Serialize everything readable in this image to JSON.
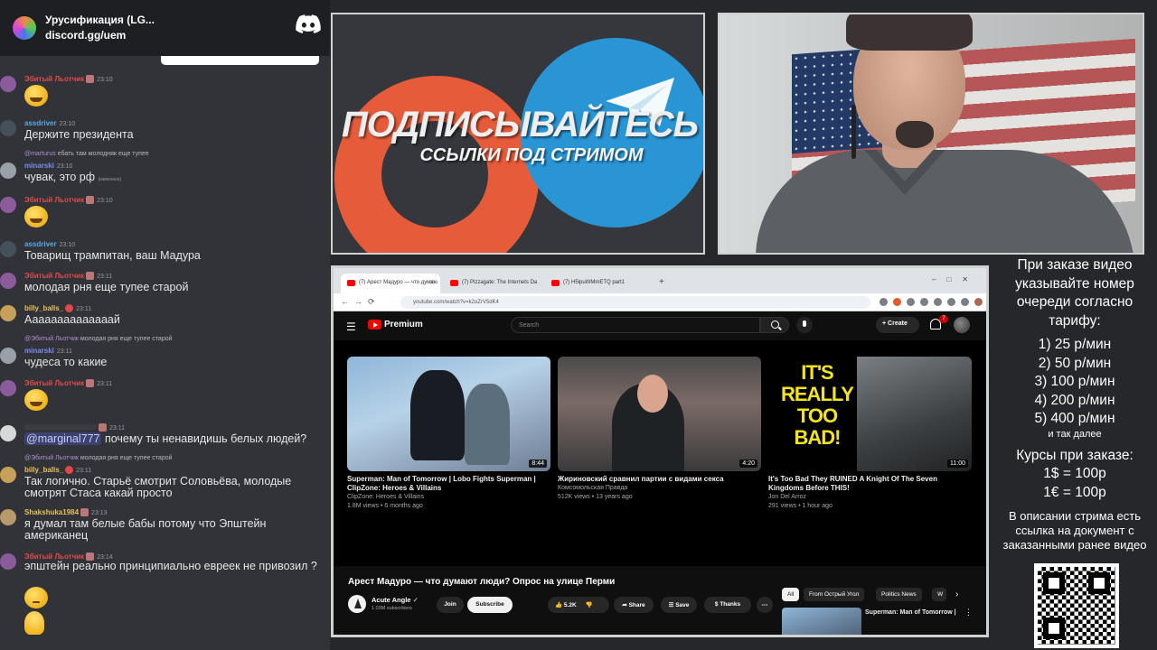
{
  "discord": {
    "server_name": "Урусификация (LG...",
    "invite": "discord.gg/uem",
    "messages": [
      {
        "user": "Эбитый Льотчик",
        "user_color": "#e24b4b",
        "time": "23:10",
        "text": "",
        "emoji": "laughing-crying"
      },
      {
        "user": "assdriver",
        "user_color": "#5aa9e6",
        "time": "23:10",
        "text": "Держите президента"
      },
      {
        "reply_user": "@marturus",
        "reply_text": "ебать там молодняк еще тупее",
        "user": "minarski",
        "user_color": "#7b8cf0",
        "time": "23:10",
        "text": "чувак, это рф",
        "edited": "(изменено)"
      },
      {
        "user": "Эбитый Льотчик",
        "user_color": "#e24b4b",
        "time": "23:10",
        "text": "",
        "emoji": "laughing-crying"
      },
      {
        "user": "assdriver",
        "user_color": "#5aa9e6",
        "time": "23:10",
        "text": "Товарищ трампитан, ваш Мадура"
      },
      {
        "user": "Эбитый Льотчик",
        "user_color": "#e24b4b",
        "time": "23:11",
        "text": "молодая рня еще тупее старой"
      },
      {
        "user": "billy_balls_",
        "user_color": "#e8c15a",
        "time": "23:11",
        "text": "Аааааааааааааай"
      },
      {
        "reply_user": "@Эбитый Льотчик",
        "reply_text": "молодая рня еще тупее старой",
        "user": "minarski",
        "user_color": "#7b8cf0",
        "time": "23:11",
        "text": "чудеса то какие"
      },
      {
        "user": "Эбитый Льотчик",
        "user_color": "#e24b4b",
        "time": "23:11",
        "text": "",
        "emoji": "laughing-crying"
      },
      {
        "user": "",
        "user_color": "#949ba4",
        "time": "23:11",
        "mention": "@marginal777",
        "text": " почему ты ненавидишь белых людей?"
      },
      {
        "reply_user": "@Эбитый Льотчик",
        "reply_text": "молодая рня еще тупее старой",
        "user": "billy_balls_",
        "user_color": "#e8c15a",
        "time": "23:11",
        "text": "Так логично. Старьё смотрит Соловьёва, молодые смотрят Стаса какай просто"
      },
      {
        "user": "Shakshuka1984",
        "user_color": "#e8c15a",
        "time": "23:13",
        "text": "я думал там белые бабы потому что Эпштейн американец"
      },
      {
        "user": "Эбитый Льотчик",
        "user_color": "#e24b4b",
        "time": "23:14",
        "text": "эпштейн реально принципиально евреек не привозил ?"
      }
    ]
  },
  "promo": {
    "title": "ПОДПИСЫВАЙТЕСЬ",
    "subtitle": "ССЫЛКИ ПОД СТРИМОМ"
  },
  "browser": {
    "tabs": [
      {
        "label": "(7) Арест Мадуро — что думаю"
      },
      {
        "label": "(7) Pizzagate: The Internets Da"
      },
      {
        "label": "(7) Н5lpuWMmETQ part1"
      }
    ],
    "url": "youtube.com/watch?v=k2oZrV5dK4",
    "youtube": {
      "logo_text": "Premium",
      "search_placeholder": "Search",
      "create_label": "Create",
      "notification_count": "7",
      "videos": [
        {
          "title": "Superman: Man of Tomorrow | Lobo Fights Superman | ClipZone: Heroes & Villains",
          "channel": "ClipZone: Heroes & Villains",
          "meta": "1.8M views • 6 months ago",
          "duration": "8:44"
        },
        {
          "title": "Жириновский сравнил партии с видами секса",
          "channel": "Комсомольская Правда",
          "meta": "512K views • 13 years ago",
          "duration": "4:20"
        },
        {
          "title": "It's Too Bad They RUINED A Knight Of The Seven Kingdoms Before THIS!",
          "channel": "Jon Del Arroz",
          "meta": "291 views • 1 hour ago",
          "duration": "11:00",
          "thumb_text": "IT'S REALLY TOO BAD!"
        }
      ],
      "watch_title": "Арест Мадуро — что думают люди? Опрос на улице Перми",
      "channel_name": "Acute Angle",
      "channel_subs": "1.03M subscribers",
      "join_label": "Join",
      "subscribe_label": "Subscribe",
      "likes": "5.2K",
      "share_label": "Share",
      "save_label": "Save",
      "thanks_label": "Thanks",
      "chips": [
        "All",
        "From Острый Угол",
        "Politics News",
        "W"
      ],
      "rec_title": "Superman: Man of Tomorrow |"
    }
  },
  "info": {
    "order_text": "При заказе видео указывайте номер очереди согласно тарифу:",
    "tariffs": [
      "1) 25 р/мин",
      "2) 50 р/мин",
      "3) 100 р/мин",
      "4) 200 р/мин",
      "5) 400 р/мин"
    ],
    "etc": "и так далее",
    "rates_title": "Курсы при заказе:",
    "rates": [
      "1$ = 100р",
      "1€ = 100р"
    ],
    "description": "В описании стрима есть ссылка на документ с заказанными ранее видео"
  }
}
